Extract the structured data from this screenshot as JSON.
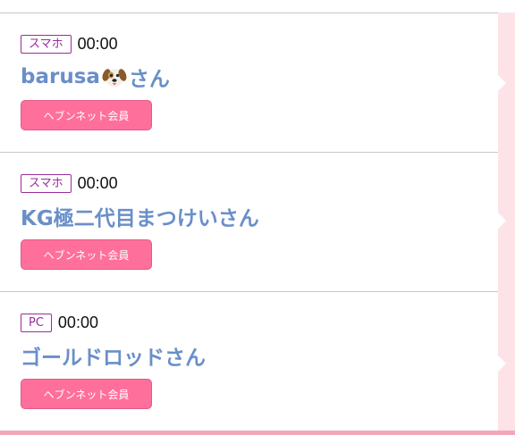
{
  "visitors": [
    {
      "device": "スマホ",
      "time": "00:00",
      "name": "barusa",
      "has_dog_icon": true,
      "suffix": "さん",
      "member_label": "ヘブンネット会員"
    },
    {
      "device": "スマホ",
      "time": "00:00",
      "name": "KG極二代目まつけい",
      "has_dog_icon": false,
      "suffix": "さん",
      "member_label": "ヘブンネット会員"
    },
    {
      "device": "PC",
      "time": "00:00",
      "name": "ゴールドロッド",
      "has_dog_icon": false,
      "suffix": "さん",
      "member_label": "ヘブンネット会員"
    }
  ],
  "icons": {
    "dog": "dog-face-icon"
  },
  "colors": {
    "name": "#6a8fc8",
    "badge": "#9b2c9b",
    "member_button": "#ff6f9c",
    "side_strip": "#fde3e7"
  }
}
